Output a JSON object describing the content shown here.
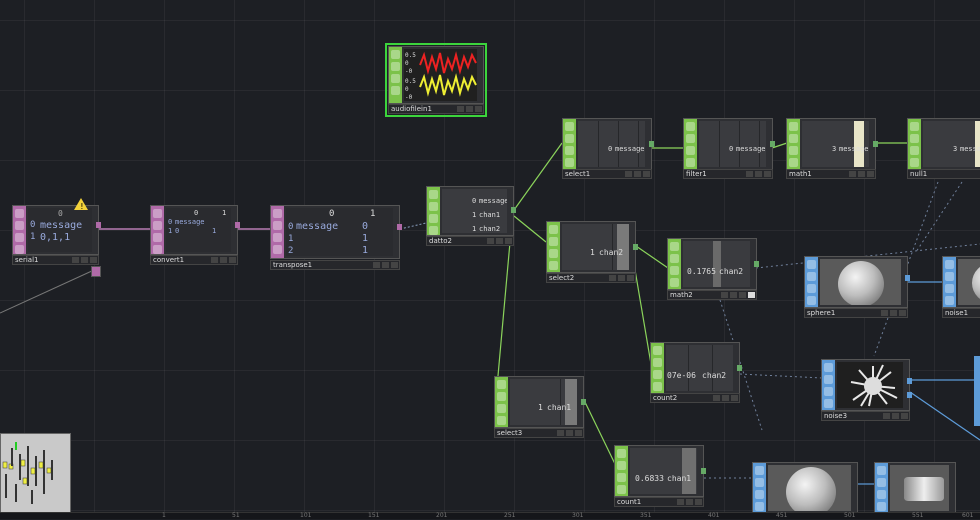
{
  "colors": {
    "chop": "#7cc24a",
    "dat": "#b06aa8",
    "top": "#5d9bd8",
    "wire_green": "#8bd45b",
    "wire_pink": "#d88fd0",
    "wire_blue": "#5d9bd8",
    "selected": "#3cd43c"
  },
  "icons": {
    "warning": "warning-icon"
  },
  "nodes": {
    "audiofilein1": {
      "label": "audiofilein1",
      "t1": "0.5",
      "t2": "0",
      "t3": "-0",
      "t4": "0.5",
      "t5": "0",
      "t6": "-0"
    },
    "serial1": {
      "label": "serial1",
      "col": "0",
      "r0i": "0",
      "r0v": "message",
      "r1i": "1",
      "r1v": "0,1,1"
    },
    "convert1": {
      "label": "convert1",
      "c0": "0",
      "c1": "1",
      "r0i": "0",
      "r0v": "message",
      "r1i": "1",
      "r1a": "0",
      "r1b": "1"
    },
    "transpose1": {
      "label": "transpose1",
      "c0": "0",
      "c1": "1",
      "r0i": "0",
      "r0a": "message",
      "r0b": "0",
      "r1i": "1",
      "r1b": "1",
      "r2i": "2",
      "r2b": "1"
    },
    "datto2": {
      "label": "datto2",
      "r0i": "0",
      "r0v": "message",
      "r1i": "1",
      "r1v": "chan1",
      "r2i": "1",
      "r2v": "chan2"
    },
    "select1": {
      "label": "select1",
      "idx": "0",
      "name": "message"
    },
    "filter1": {
      "label": "filter1",
      "idx": "0",
      "name": "message"
    },
    "math1": {
      "label": "math1",
      "idx": "3",
      "name": "message"
    },
    "null1": {
      "label": "null1",
      "idx": "3",
      "name": "message"
    },
    "select2": {
      "label": "select2",
      "idx": "1",
      "name": "chan2"
    },
    "math2": {
      "label": "math2",
      "val": "0.1765",
      "name": "chan2"
    },
    "count2": {
      "label": "count2",
      "val": "07e-06",
      "name": "chan2"
    },
    "select3": {
      "label": "select3",
      "idx": "1",
      "name": "chan1"
    },
    "count1": {
      "label": "count1",
      "val": "0.6833",
      "name": "chan1"
    },
    "sphere1": {
      "label": "sphere1"
    },
    "noise1": {
      "label": "noise1"
    },
    "noise3": {
      "label": "noise3"
    }
  },
  "ruler": {
    "ticks": [
      "1",
      "51",
      "101",
      "151",
      "201",
      "251",
      "301",
      "351",
      "401",
      "451",
      "501",
      "551",
      "601"
    ]
  }
}
